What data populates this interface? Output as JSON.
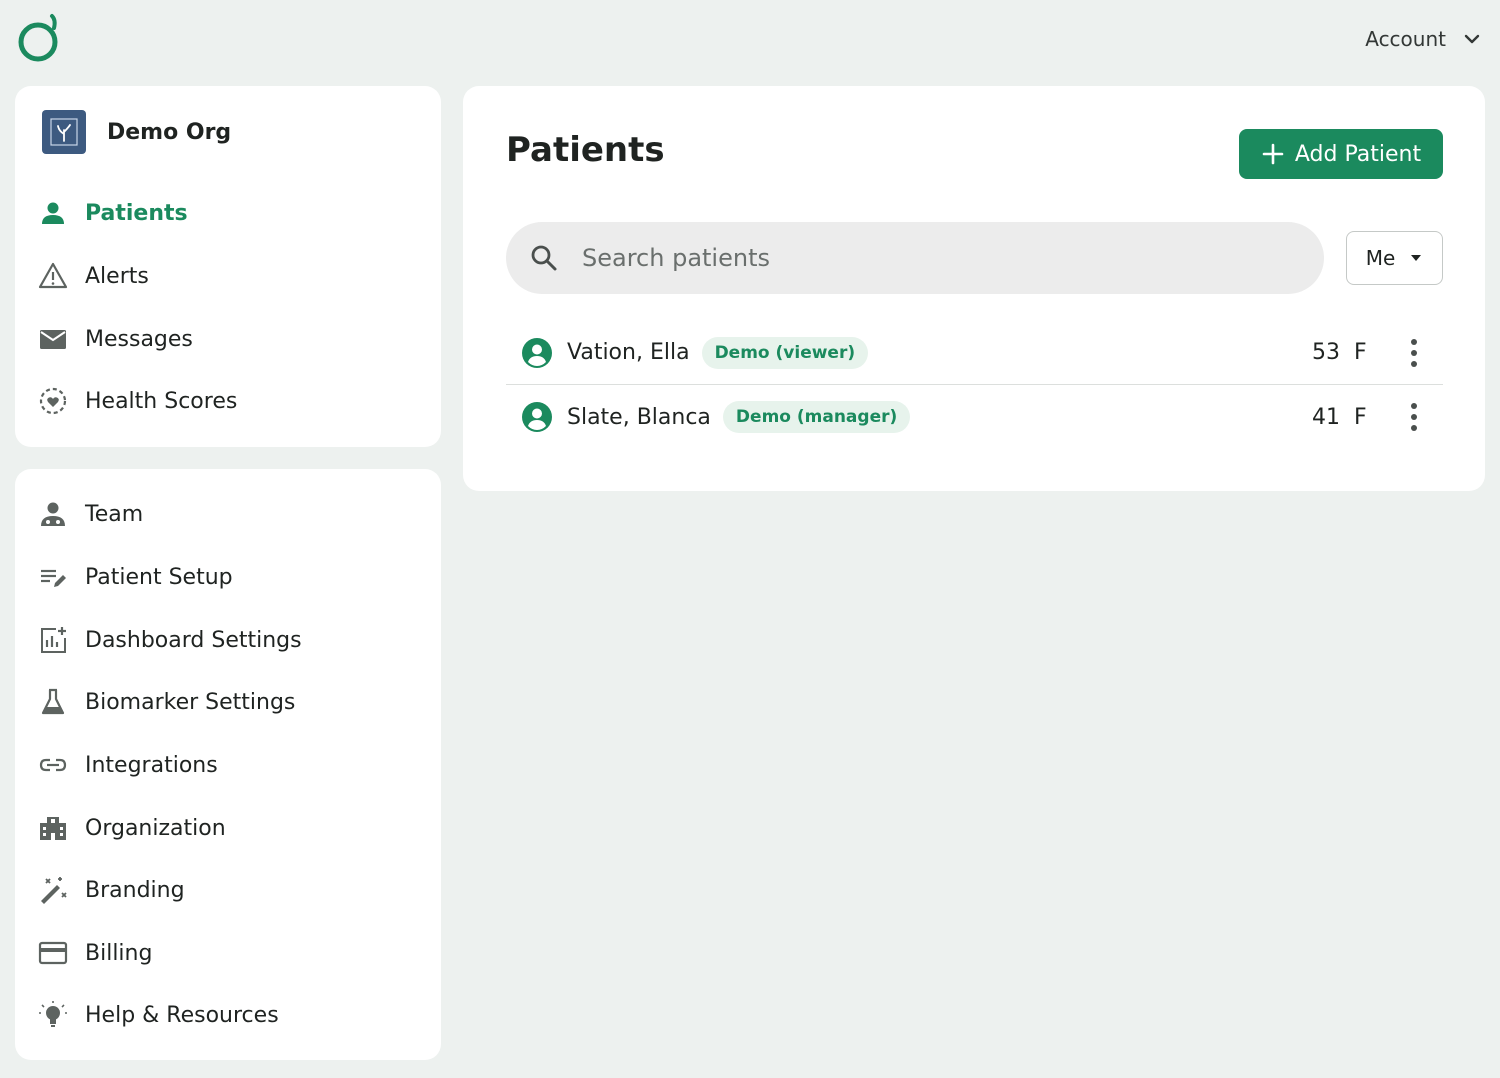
{
  "header": {
    "account_label": "Account"
  },
  "org": {
    "name": "Demo Org"
  },
  "sidebar": {
    "primary": [
      {
        "label": "Patients",
        "icon": "person-icon",
        "active": true
      },
      {
        "label": "Alerts",
        "icon": "warning-icon"
      },
      {
        "label": "Messages",
        "icon": "envelope-icon"
      },
      {
        "label": "Health Scores",
        "icon": "heart-circle-icon"
      }
    ],
    "secondary": [
      {
        "label": "Team",
        "icon": "team-icon"
      },
      {
        "label": "Patient Setup",
        "icon": "edit-list-icon"
      },
      {
        "label": "Dashboard Settings",
        "icon": "chart-add-icon"
      },
      {
        "label": "Biomarker Settings",
        "icon": "flask-icon"
      },
      {
        "label": "Integrations",
        "icon": "link-icon"
      },
      {
        "label": "Organization",
        "icon": "building-icon"
      },
      {
        "label": "Branding",
        "icon": "magic-wand-icon"
      },
      {
        "label": "Billing",
        "icon": "credit-card-icon"
      },
      {
        "label": "Help & Resources",
        "icon": "lightbulb-icon"
      }
    ]
  },
  "main": {
    "title": "Patients",
    "add_button_label": "Add Patient",
    "search_placeholder": "Search patients",
    "filter_value": "Me",
    "patients": [
      {
        "name": "Vation, Ella",
        "badge": "Demo (viewer)",
        "age": "53",
        "sex": "F"
      },
      {
        "name": "Slate, Blanca",
        "badge": "Demo (manager)",
        "age": "41",
        "sex": "F"
      }
    ]
  },
  "colors": {
    "brand_green": "#1b8a5e",
    "badge_bg": "#e7f3ec",
    "page_bg": "#edf1ef",
    "org_avatar_bg": "#3d5a80"
  }
}
